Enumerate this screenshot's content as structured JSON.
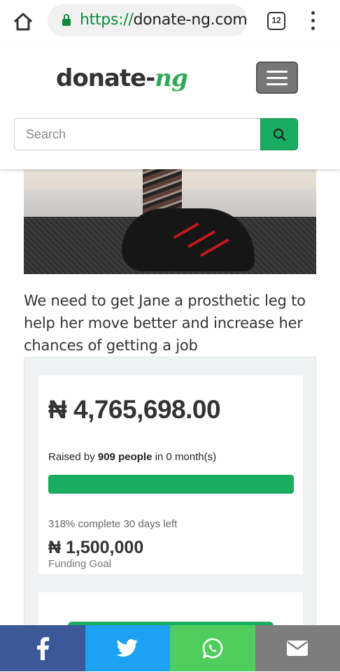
{
  "browser": {
    "url_scheme": "https://",
    "url_host": "donate-ng.com/",
    "tab_count": "12"
  },
  "header": {
    "logo_text": "donate-",
    "logo_accent": "ng",
    "search_placeholder": "Search"
  },
  "campaign": {
    "description": "We need to get Jane a prosthetic leg to help her move better and increase her chances of getting a job",
    "amount_raised": "₦ 4,765,698.00",
    "raised_prefix": "Raised by ",
    "people": "909 people",
    "raised_suffix": " in 0 month(s)",
    "progress_text": "318% complete 30 days left",
    "progress_fraction": 1.0,
    "goal_amount": "₦ 1,500,000",
    "goal_label": "Funding Goal"
  },
  "share": {
    "items": [
      "facebook-icon",
      "twitter-icon",
      "whatsapp-icon",
      "email-icon"
    ]
  },
  "colors": {
    "brand_green": "#1aac60",
    "facebook": "#3b5998",
    "twitter": "#1da1f2",
    "whatsapp": "#4fce5d",
    "email": "#7d7d7d"
  }
}
